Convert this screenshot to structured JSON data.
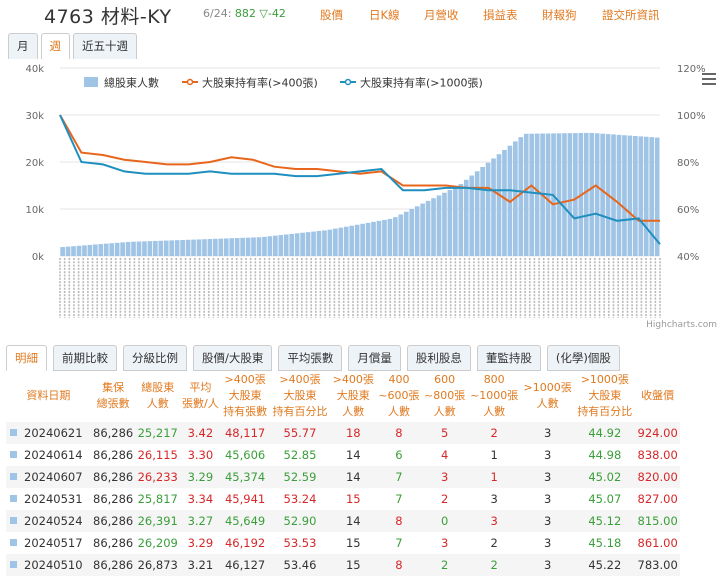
{
  "header": {
    "code": "4763",
    "name": "材料-KY",
    "date": "6/24:",
    "price": "882",
    "change": "▽-42",
    "links": [
      "股價",
      "日K線",
      "月營收",
      "損益表",
      "財報狗",
      "證交所資訊"
    ]
  },
  "period_tabs": [
    "月",
    "週",
    "近五十週"
  ],
  "active_period": "週",
  "chart_data": {
    "type": "line",
    "legend": [
      "總股東人數",
      "大股東持有率(>400張)",
      "大股東持有率(>1000張)"
    ],
    "y_left_ticks": [
      "0k",
      "10k",
      "20k",
      "30k",
      "40k"
    ],
    "y_right_ticks": [
      "40%",
      "60%",
      "80%",
      "100%",
      "120%"
    ],
    "ylim_left": [
      0,
      40000
    ],
    "ylim_right": [
      40,
      120
    ],
    "colors": {
      "bars": "#9fc4e6",
      "line400": "#e8661c",
      "line1000": "#1f8fbf"
    },
    "series": [
      {
        "name": "總股東人數",
        "kind": "bar",
        "values": [
          1900,
          3000,
          3500,
          4000,
          5500,
          8000,
          15000,
          26000,
          26200,
          25200
        ]
      },
      {
        "name": "大股東持有率(>400張)",
        "kind": "line",
        "values": [
          100,
          84,
          83,
          81,
          80,
          79,
          79,
          80,
          82,
          81,
          78,
          77,
          77,
          76,
          75,
          76,
          70,
          70,
          70,
          69,
          69,
          63,
          70,
          62,
          64,
          70,
          63,
          55,
          55
        ]
      },
      {
        "name": "大股東持有率(>1000張)",
        "kind": "line",
        "values": [
          100,
          80,
          79,
          76,
          75,
          75,
          75,
          76,
          75,
          75,
          75,
          74,
          74,
          75,
          76,
          77,
          68,
          68,
          69,
          69,
          68,
          68,
          67,
          66,
          56,
          58,
          55,
          56,
          45
        ]
      }
    ],
    "credit": "Highcharts.com"
  },
  "table_tabs": [
    "明細",
    "前期比較",
    "分級比例",
    "股價/大股東",
    "平均張數",
    "月償量",
    "股利股息",
    "董監持股",
    "(化學)個股"
  ],
  "active_table_tab": "明細",
  "columns": [
    [
      "資料日期"
    ],
    [
      "集保",
      "總張數"
    ],
    [
      "總股東",
      "人數"
    ],
    [
      "平均",
      "張數/人"
    ],
    [
      ">400張",
      "大股東",
      "持有張數"
    ],
    [
      ">400張",
      "大股東",
      "持有百分比"
    ],
    [
      ">400張",
      "大股東",
      "人數"
    ],
    [
      "400",
      "~600張",
      "人數"
    ],
    [
      "600",
      "~800張",
      "人數"
    ],
    [
      "800",
      "~1000張",
      "人數"
    ],
    [
      ">1000張",
      "人數"
    ],
    [
      ">1000張",
      "大股東",
      "持有百分比"
    ],
    [
      "收盤價"
    ]
  ],
  "rows": [
    [
      "20240621",
      "86,286",
      "25,217",
      "3.42",
      "48,117",
      "55.77",
      "18",
      "8",
      "5",
      "2",
      "3",
      "44.92",
      "924.00"
    ],
    [
      "20240614",
      "86,286",
      "26,115",
      "3.30",
      "45,606",
      "52.85",
      "14",
      "6",
      "4",
      "1",
      "3",
      "44.98",
      "838.00"
    ],
    [
      "20240607",
      "86,286",
      "26,233",
      "3.29",
      "45,374",
      "52.59",
      "14",
      "7",
      "3",
      "1",
      "3",
      "45.02",
      "820.00"
    ],
    [
      "20240531",
      "86,286",
      "25,817",
      "3.34",
      "45,941",
      "53.24",
      "15",
      "7",
      "2",
      "3",
      "3",
      "45.07",
      "827.00"
    ],
    [
      "20240524",
      "86,286",
      "26,391",
      "3.27",
      "45,649",
      "52.90",
      "14",
      "8",
      "0",
      "3",
      "3",
      "45.12",
      "815.00"
    ],
    [
      "20240517",
      "86,286",
      "26,209",
      "3.29",
      "46,192",
      "53.53",
      "15",
      "7",
      "3",
      "2",
      "3",
      "45.18",
      "861.00"
    ],
    [
      "20240510",
      "86,286",
      "26,873",
      "3.21",
      "46,127",
      "53.46",
      "15",
      "8",
      "2",
      "2",
      "3",
      "45.22",
      "783.00"
    ]
  ]
}
